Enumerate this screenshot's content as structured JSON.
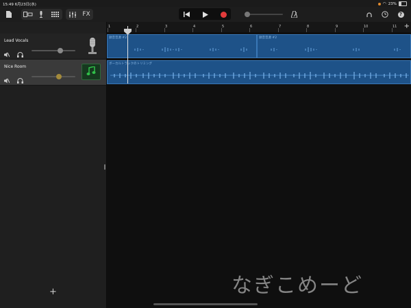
{
  "status": {
    "time": "15:49",
    "date": "6月23日(水)",
    "battery": "23%"
  },
  "toolbar": {
    "icons_left": [
      "document-icon",
      "view-toggle-icon",
      "mic-icon",
      "keyboard-grid-icon",
      "mixer-icon"
    ],
    "fx_label": "FX",
    "icons_right": [
      "loop-icon",
      "clock-icon",
      "help-icon"
    ]
  },
  "ruler": {
    "bars": [
      "1",
      "2",
      "3",
      "4",
      "5",
      "6",
      "7",
      "8",
      "9",
      "10",
      "11"
    ],
    "add_label": "+"
  },
  "tracks": [
    {
      "name": "Lead Vocals",
      "volume": 0.68,
      "instrument": "microphone-icon",
      "selected": false,
      "regions": [
        {
          "label": "録音音源 #2"
        },
        {
          "label": "録音音源 #2"
        }
      ]
    },
    {
      "name": "Nice Room",
      "volume": 0.62,
      "instrument": "music-note-icon",
      "selected": true,
      "regions": [
        {
          "label": "ボーカルトラックのトリミング"
        }
      ]
    }
  ],
  "sidebar": {
    "add_track_label": "+"
  },
  "watermark": "なぎこめーど",
  "colors": {
    "region_fill": "#1e5288",
    "region_border": "#3a78b7",
    "record": "#e23b3b",
    "instrument_green": "#31c04a"
  }
}
